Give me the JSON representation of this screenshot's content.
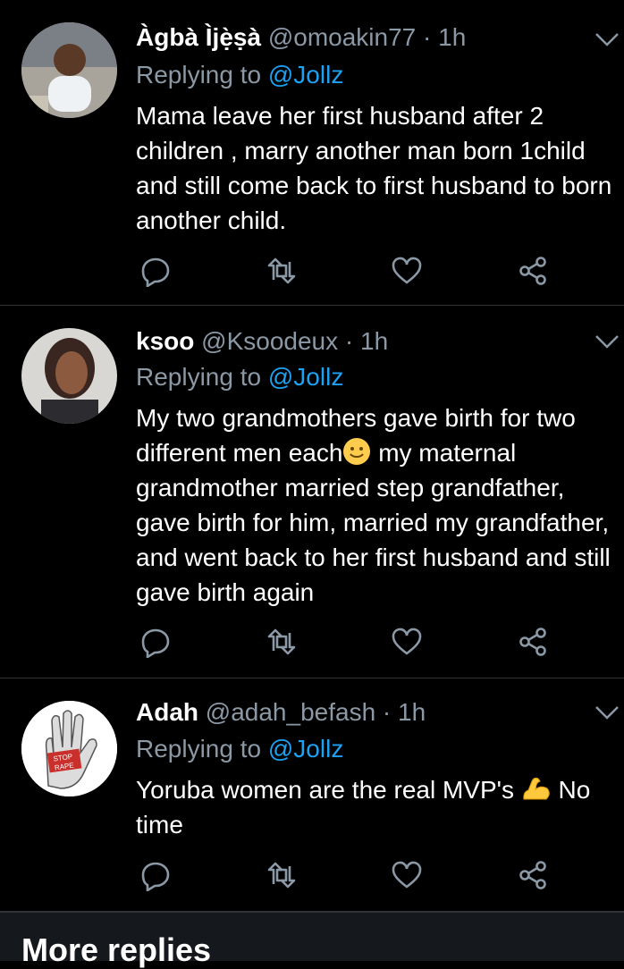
{
  "tweets": [
    {
      "name": "Àgbà Ìjẹ̀ṣà",
      "handle": "@omoakin77",
      "dot": "·",
      "time": "1h",
      "replying_prefix": "Replying to",
      "replying_to": "@Jollz",
      "text": "Mama leave her first husband after 2 children , marry another man born 1child and still come back to first husband to born another child."
    },
    {
      "name": "ksoo",
      "handle": "@Ksoodeux",
      "dot": "·",
      "time": "1h",
      "replying_prefix": "Replying to",
      "replying_to": "@Jollz",
      "text_before_emoji": "My two grandmothers gave birth for two different men each",
      "emoji": "slightly-smiling-face-icon",
      "text_after_emoji": " my maternal grandmother married step grandfather, gave birth for him, married my grandfather, and went back to her first husband and still gave birth again"
    },
    {
      "name": "Adah",
      "handle": "@adah_befash",
      "dot": "·",
      "time": "1h",
      "replying_prefix": "Replying to",
      "replying_to": "@Jollz",
      "text_before_emoji": "Yoruba women are the real MVP's ",
      "emoji": "flexed-biceps-icon",
      "text_after_emoji": " No time",
      "avatar_sign_text": [
        "STOP",
        "RAPE"
      ]
    }
  ],
  "footer": {
    "more_replies": "More replies"
  },
  "colors": {
    "background": "#000000",
    "secondary_text": "#8b98a5",
    "link": "#1da1f2",
    "divider": "#2f3336"
  }
}
